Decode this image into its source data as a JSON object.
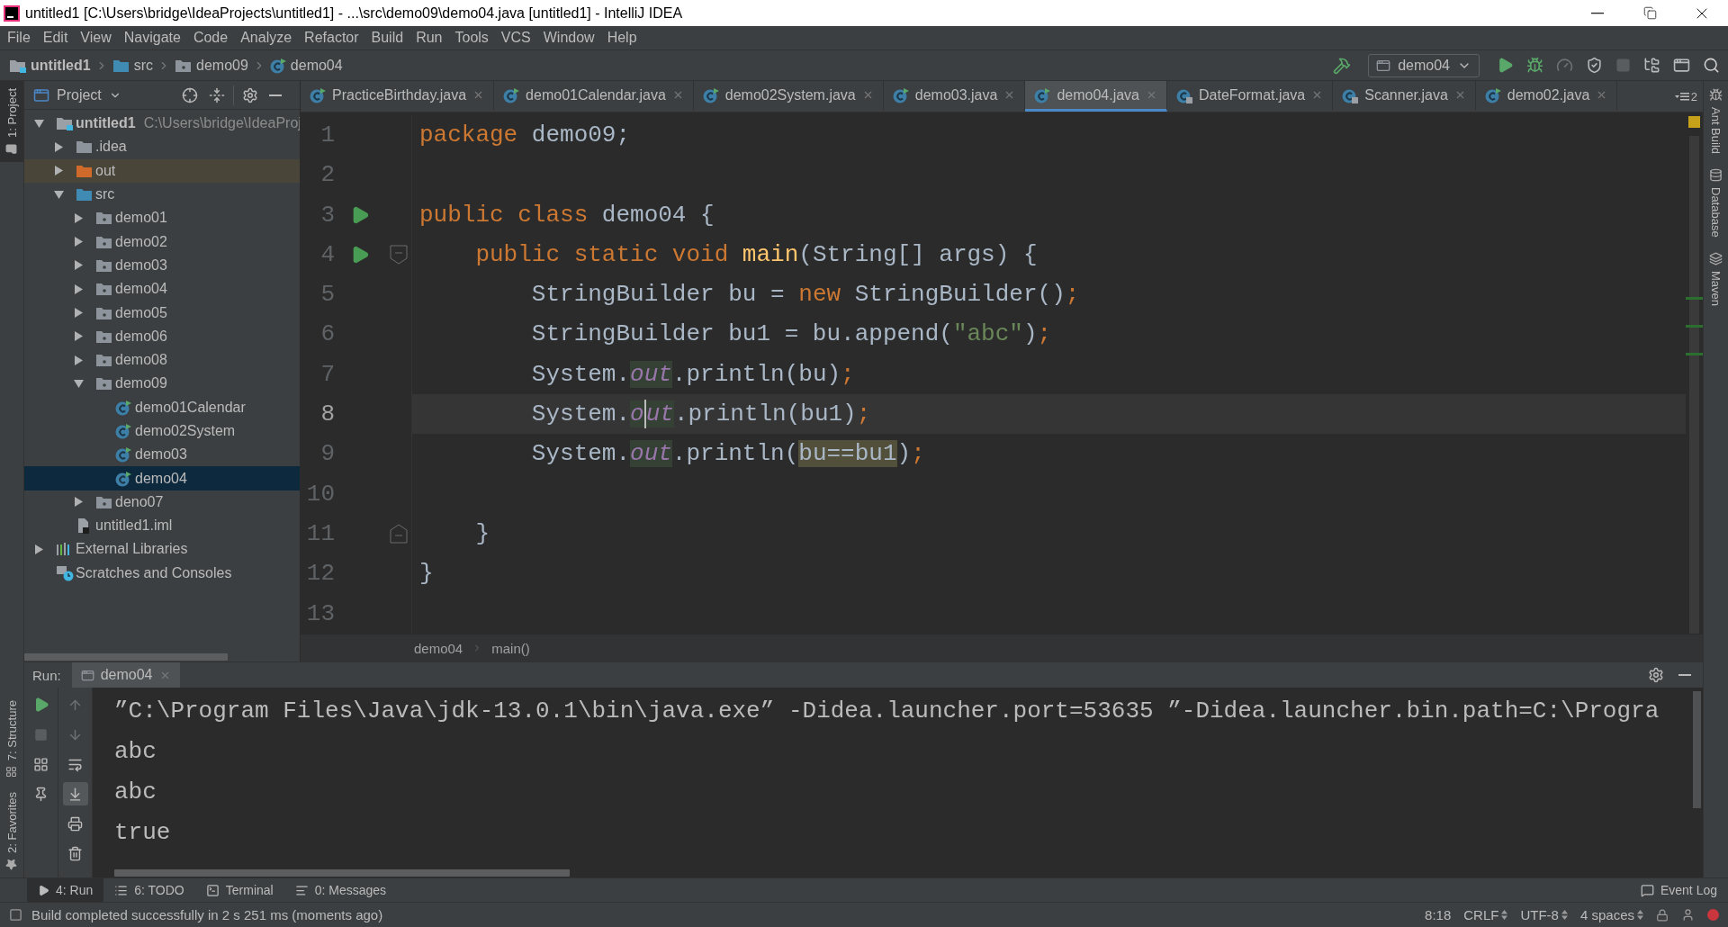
{
  "window": {
    "title": "untitled1 [C:\\Users\\bridge\\IdeaProjects\\untitled1] - ...\\src\\demo09\\demo04.java [untitled1] - IntelliJ IDEA"
  },
  "menu": [
    "File",
    "Edit",
    "View",
    "Navigate",
    "Code",
    "Analyze",
    "Refactor",
    "Build",
    "Run",
    "Tools",
    "VCS",
    "Window",
    "Help"
  ],
  "breadcrumb": [
    {
      "label": "untitled1",
      "kind": "module"
    },
    {
      "label": "src",
      "kind": "source"
    },
    {
      "label": "demo09",
      "kind": "package"
    },
    {
      "label": "demo04",
      "kind": "class"
    }
  ],
  "run_config": {
    "label": "demo04"
  },
  "left_tool_windows_top": [
    {
      "label": "1: Project",
      "kind": "project",
      "selected": true
    }
  ],
  "left_tool_windows_bottom": [
    {
      "label": "7: Structure",
      "kind": "structure",
      "selected": false
    },
    {
      "label": "2: Favorites",
      "kind": "favorites",
      "selected": false
    }
  ],
  "right_tool_windows": [
    {
      "label": "Ant Build",
      "kind": "ant"
    },
    {
      "label": "Database",
      "kind": "database"
    },
    {
      "label": "Maven",
      "kind": "maven"
    }
  ],
  "project": {
    "title": "Project",
    "tree": [
      {
        "label": "untitled1",
        "path": "C:\\Users\\bridge\\IdeaProj",
        "kind": "module",
        "expanded": true,
        "selected": false,
        "children": [
          {
            "label": ".idea",
            "kind": "folder",
            "expanded": false,
            "selected": false
          },
          {
            "label": "out",
            "kind": "excluded",
            "expanded": false,
            "selected": false
          },
          {
            "label": "src",
            "kind": "source",
            "expanded": true,
            "selected": false,
            "children": [
              {
                "label": "demo01",
                "kind": "package",
                "expanded": false,
                "selected": false
              },
              {
                "label": "demo02",
                "kind": "package",
                "expanded": false,
                "selected": false
              },
              {
                "label": "demo03",
                "kind": "package",
                "expanded": false,
                "selected": false
              },
              {
                "label": "demo04",
                "kind": "package",
                "expanded": false,
                "selected": false
              },
              {
                "label": "demo05",
                "kind": "package",
                "expanded": false,
                "selected": false
              },
              {
                "label": "demo06",
                "kind": "package",
                "expanded": false,
                "selected": false
              },
              {
                "label": "demo08",
                "kind": "package",
                "expanded": false,
                "selected": false
              },
              {
                "label": "demo09",
                "kind": "package",
                "expanded": true,
                "selected": false,
                "children": [
                  {
                    "label": "demo01Calendar",
                    "kind": "class",
                    "selected": false
                  },
                  {
                    "label": "demo02System",
                    "kind": "class",
                    "selected": false
                  },
                  {
                    "label": "demo03",
                    "kind": "class",
                    "selected": false
                  },
                  {
                    "label": "demo04",
                    "kind": "class",
                    "selected": true
                  }
                ]
              },
              {
                "label": "deno07",
                "kind": "package",
                "expanded": false,
                "selected": false
              }
            ]
          },
          {
            "label": "untitled1.iml",
            "kind": "iml",
            "selected": false
          }
        ]
      },
      {
        "label": "External Libraries",
        "kind": "library",
        "expanded": false,
        "selected": false
      },
      {
        "label": "Scratches and Consoles",
        "kind": "scratch",
        "selected": false
      }
    ]
  },
  "editor_tabs": [
    {
      "label": "PracticeBirthday.java",
      "kind": "class",
      "selected": false
    },
    {
      "label": "demo01Calendar.java",
      "kind": "class",
      "selected": false
    },
    {
      "label": "demo02System.java",
      "kind": "class",
      "selected": false
    },
    {
      "label": "demo03.java",
      "kind": "class",
      "selected": false
    },
    {
      "label": "demo04.java",
      "kind": "class",
      "selected": true
    },
    {
      "label": "DateFormat.java",
      "kind": "library",
      "selected": false
    },
    {
      "label": "Scanner.java",
      "kind": "library",
      "selected": false
    },
    {
      "label": "demo02.java",
      "kind": "class",
      "selected": false
    }
  ],
  "tab_overflow_count": "2",
  "code": {
    "lines": [
      {
        "number": "1",
        "current": false,
        "run_marker": false,
        "fold_start": false,
        "fold_end": false,
        "tokens": [
          {
            "text": "package",
            "kind": "keyword"
          },
          {
            "text": " demo09;",
            "kind": "plain"
          }
        ]
      },
      {
        "number": "2",
        "current": false,
        "run_marker": false,
        "fold_start": false,
        "fold_end": false
      },
      {
        "number": "3",
        "current": false,
        "run_marker": true,
        "fold_start": false,
        "fold_end": false,
        "tokens": [
          {
            "text": "public class",
            "kind": "keyword"
          },
          {
            "text": " demo04 {",
            "kind": "plain"
          }
        ]
      },
      {
        "number": "4",
        "current": false,
        "run_marker": true,
        "fold_start": true,
        "fold_end": false,
        "tokens": [
          {
            "text": "    public static void",
            "kind": "keyword"
          },
          {
            "text": " main",
            "kind": "method"
          },
          {
            "text": "(String[] args) {",
            "kind": "plain"
          }
        ]
      },
      {
        "number": "5",
        "current": false,
        "run_marker": false,
        "fold_start": false,
        "fold_end": false,
        "tokens": [
          {
            "text": "        StringBuilder bu = ",
            "kind": "plain"
          },
          {
            "text": "new",
            "kind": "keyword"
          },
          {
            "text": " StringBuilder()",
            "kind": "plain"
          },
          {
            "text": ";",
            "kind": "keyword"
          }
        ]
      },
      {
        "number": "6",
        "current": false,
        "run_marker": false,
        "fold_start": false,
        "fold_end": false,
        "tokens": [
          {
            "text": "        StringBuilder bu1 = bu.append(",
            "kind": "plain"
          },
          {
            "text": "\"abc\"",
            "kind": "string"
          },
          {
            "text": ")",
            "kind": "plain"
          },
          {
            "text": ";",
            "kind": "keyword"
          }
        ]
      },
      {
        "number": "7",
        "current": false,
        "run_marker": false,
        "fold_start": false,
        "fold_end": false,
        "tokens": [
          {
            "text": "        System.",
            "kind": "plain"
          },
          {
            "text": "out",
            "kind": "field_usage"
          },
          {
            "text": ".println(bu)",
            "kind": "plain"
          },
          {
            "text": ";",
            "kind": "keyword"
          }
        ]
      },
      {
        "number": "8",
        "current": true,
        "run_marker": false,
        "fold_start": false,
        "fold_end": false,
        "tokens": [
          {
            "text": "        System.",
            "kind": "plain",
            "caret_before": false
          },
          {
            "text": "o",
            "kind": "field_usage",
            "caret_before": false
          },
          {
            "text": "ut",
            "kind": "field_usage",
            "caret_before": true
          },
          {
            "text": ".println(bu1)",
            "kind": "plain",
            "caret_before": false
          },
          {
            "text": ";",
            "kind": "keyword",
            "caret_before": false
          }
        ]
      },
      {
        "number": "9",
        "current": false,
        "run_marker": false,
        "fold_start": false,
        "fold_end": false,
        "tokens": [
          {
            "text": "        System.",
            "kind": "plain"
          },
          {
            "text": "out",
            "kind": "field_usage"
          },
          {
            "text": ".println(",
            "kind": "plain"
          },
          {
            "text": "bu==bu1",
            "kind": "warning"
          },
          {
            "text": ")",
            "kind": "plain"
          },
          {
            "text": ";",
            "kind": "keyword"
          }
        ]
      },
      {
        "number": "10",
        "current": false,
        "run_marker": false,
        "fold_start": false,
        "fold_end": false
      },
      {
        "number": "11",
        "current": false,
        "run_marker": false,
        "fold_start": false,
        "fold_end": true,
        "tokens": [
          {
            "text": "    }",
            "kind": "plain"
          }
        ]
      },
      {
        "number": "12",
        "current": false,
        "run_marker": false,
        "fold_start": false,
        "fold_end": false,
        "tokens": [
          {
            "text": "}",
            "kind": "plain"
          }
        ]
      },
      {
        "number": "13",
        "current": false,
        "run_marker": false,
        "fold_start": false,
        "fold_end": false
      }
    ]
  },
  "editor_breadcrumb": [
    "demo04",
    "main()"
  ],
  "run": {
    "label": "Run:",
    "tab": "demo04",
    "console": [
      "”C:\\Program Files\\Java\\jdk-13.0.1\\bin\\java.exe” -Didea.launcher.port=53635 ”-Didea.launcher.bin.path=C:\\Progra",
      "abc",
      "abc",
      "true"
    ]
  },
  "bottom_tabs": [
    {
      "label": "4: Run",
      "kind": "run",
      "selected": true
    },
    {
      "label": "6: TODO",
      "kind": "todo",
      "selected": false
    },
    {
      "label": "Terminal",
      "kind": "terminal",
      "selected": false
    },
    {
      "label": "0: Messages",
      "kind": "messages",
      "selected": false
    }
  ],
  "event_log": "Event Log",
  "status": {
    "message": "Build completed successfully in 2 s 251 ms (moments ago)",
    "items": [
      {
        "text": "8:18",
        "dropdown": false
      },
      {
        "text": "CRLF",
        "dropdown": true
      },
      {
        "text": "UTF-8",
        "dropdown": true
      },
      {
        "text": "4 spaces",
        "dropdown": true
      }
    ]
  }
}
